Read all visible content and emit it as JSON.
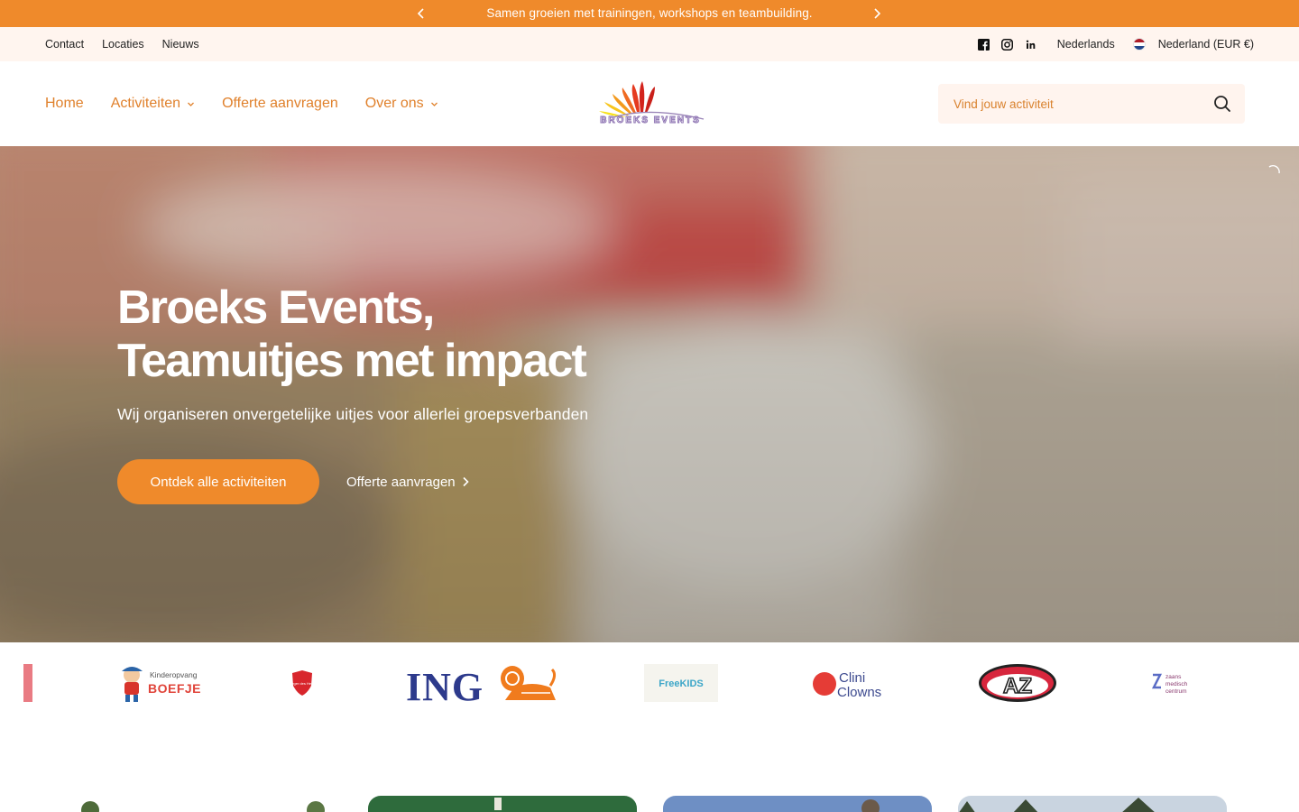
{
  "announcement": {
    "text": "Samen groeien met trainingen, workshops en teambuilding.",
    "prev_icon": "chevron-left-icon",
    "next_icon": "chevron-right-icon"
  },
  "utility": {
    "links": [
      "Contact",
      "Locaties",
      "Nieuws"
    ],
    "social": [
      "facebook-icon",
      "instagram-icon",
      "linkedin-icon"
    ],
    "language": "Nederlands",
    "country": "Nederland (EUR €)"
  },
  "header": {
    "nav": [
      {
        "label": "Home",
        "dropdown": false
      },
      {
        "label": "Activiteiten",
        "dropdown": true
      },
      {
        "label": "Offerte aanvragen",
        "dropdown": false
      },
      {
        "label": "Over ons",
        "dropdown": true
      }
    ],
    "logo_text": "BROEKS EVENTS",
    "search_placeholder": "Vind jouw activiteit"
  },
  "hero": {
    "title_line1": "Broeks Events,",
    "title_line2": "Teamuitjes met impact",
    "subtitle": "Wij organiseren onvergetelijke uitjes voor allerlei groepsverbanden",
    "cta_label": "Ontdek alle activiteiten",
    "secondary_label": "Offerte aanvragen"
  },
  "partners": {
    "boefje_small": "Kinderopvang",
    "boefje": "BOEFJE",
    "salvation": "Leger des Heils",
    "ing": "ING",
    "freekids": "FreeKIDS",
    "cliniclowns_1": "Clini",
    "cliniclowns_2": "Clowns",
    "az": "AZ",
    "zaans_1": "zaans",
    "zaans_2": "medisch",
    "zaans_3": "centrum"
  },
  "colors": {
    "brand_orange": "#ef8a2b",
    "nav_orange": "#e0812c",
    "utility_bg": "#fff5ef"
  }
}
